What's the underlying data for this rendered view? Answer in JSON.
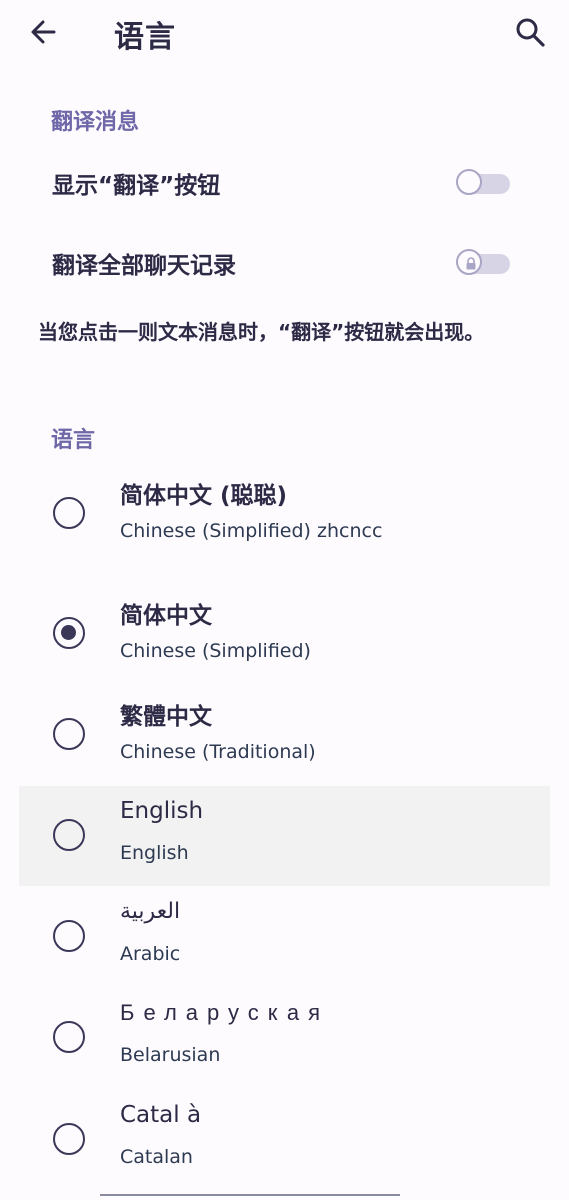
{
  "header": {
    "title": "语言",
    "back_icon": "arrow-left-icon",
    "search_icon": "search-icon"
  },
  "translate_section": {
    "header": "翻译消息",
    "toggles": [
      {
        "label": "显示“翻译”按钮",
        "on": false,
        "locked": false
      },
      {
        "label": "翻译全部聊天记录",
        "on": false,
        "locked": true
      }
    ],
    "description": "当您点击一则文本消息时，“翻译”按钮就会出现。"
  },
  "language_section": {
    "header": "语言",
    "items": [
      {
        "name": "简体中文 (聪聪)",
        "sub": "Chinese (Simplified) zhcncc",
        "selected": false
      },
      {
        "name": "简体中文",
        "sub": "Chinese (Simplified)",
        "selected": true
      },
      {
        "name": "繁體中文",
        "sub": "Chinese (Traditional)",
        "selected": false
      },
      {
        "name": "English",
        "sub": "English",
        "selected": false,
        "highlighted": true
      },
      {
        "name": "العربية",
        "sub": "Arabic",
        "selected": false
      },
      {
        "name": "Беларуская",
        "sub": "Belarusian",
        "selected": false
      },
      {
        "name": "Catal à",
        "sub": "Catalan",
        "selected": false
      }
    ]
  },
  "colors": {
    "background": "#fdfbfe",
    "accent": "#6e67a8",
    "text": "#2d2a46",
    "highlight_row": "#f2f2f2"
  }
}
